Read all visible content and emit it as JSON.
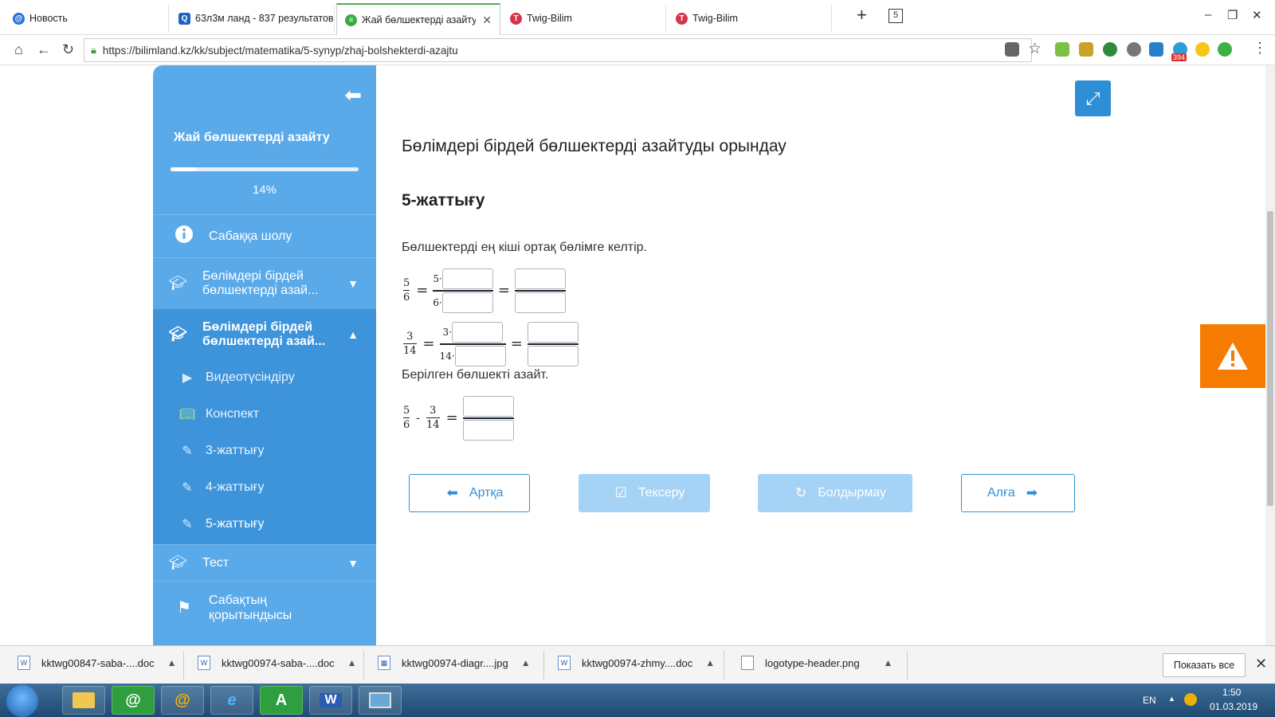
{
  "browser": {
    "tabs": [
      {
        "title": "Новость",
        "active": false
      },
      {
        "title": "63л3м ланд - 837 результатов",
        "active": false
      },
      {
        "title": "Жай бөлшектерді азайту - М",
        "active": true
      },
      {
        "title": "Twig-Bilim",
        "active": false
      },
      {
        "title": "Twig-Bilim",
        "active": false
      }
    ],
    "tab_count_badge": "5",
    "url": "https://bilimland.kz/kk/subject/matematika/5-synyp/zhaj-bolshekterdi-azajtu",
    "ext_badge": "394"
  },
  "sidebar": {
    "title": "Жай бөлшектерді азайту",
    "progress_pct": 14,
    "progress_label": "14%",
    "items": [
      {
        "label": "Сабаққа шолу",
        "icon": "info-icon"
      },
      {
        "label": "Бөлімдері бірдей бөлшектерді азай...",
        "icon": "graduation-cap-icon",
        "expanded": false
      },
      {
        "label": "Бөлімдері бірдей бөлшектерді азай...",
        "icon": "graduation-cap-icon",
        "expanded": true
      },
      {
        "label": "Тест",
        "icon": "graduation-cap-icon",
        "expanded": false
      },
      {
        "label": "Сабақтың қорытындысы",
        "icon": "flag-icon"
      }
    ],
    "subitems": [
      {
        "label": "Видеотүсіндіру",
        "icon": "play-icon"
      },
      {
        "label": "Конспект",
        "icon": "book-icon"
      },
      {
        "label": "3-жаттығу",
        "icon": "edit-icon"
      },
      {
        "label": "4-жаттығу",
        "icon": "edit-icon"
      },
      {
        "label": "5-жаттығу",
        "icon": "edit-icon"
      }
    ]
  },
  "main": {
    "heading": "Бөлімдері бірдей бөлшектерді азайтуды орындау",
    "exercise_title": "5-жаттығу",
    "instruction1": "Бөлшектерді ең кіші ортақ бөлімге келтір.",
    "instruction2": "Берілген бөлшекті азайт.",
    "eq1": {
      "num": "5",
      "den": "6",
      "mul_num": "5·",
      "mul_den": "6·"
    },
    "eq2": {
      "num": "3",
      "den": "14",
      "mul_num": "3·",
      "mul_den": "14·"
    },
    "eq3": {
      "a_num": "5",
      "a_den": "6",
      "minus": "-",
      "b_num": "3",
      "b_den": "14"
    },
    "equals": "="
  },
  "buttons": {
    "back": "Артқа",
    "check": "Тексеру",
    "cancel": "Болдырмау",
    "next": "Алға"
  },
  "downloads": {
    "files": [
      "kktwg00847-saba-....doc",
      "kktwg00974-saba-....doc",
      "kktwg00974-diagr....jpg",
      "kktwg00974-zhmy....doc",
      "logotype-header.png"
    ],
    "show_all": "Показать все"
  },
  "taskbar": {
    "lang": "EN",
    "time": "1:50",
    "date": "01.03.2019"
  }
}
